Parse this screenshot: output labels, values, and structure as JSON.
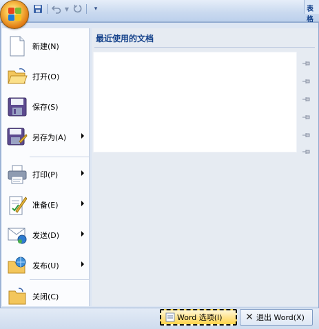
{
  "titlebar": {
    "tab_fragment": "表格"
  },
  "qat": {
    "save_icon": "save-icon",
    "undo_icon": "undo-icon",
    "redo_icon": "redo-icon",
    "customize_icon": "customize-qat-icon"
  },
  "menu": {
    "items": [
      {
        "label": "新建(N)",
        "icon": "new-document-icon",
        "has_submenu": false
      },
      {
        "label": "打开(O)",
        "icon": "open-folder-icon",
        "has_submenu": false
      },
      {
        "label": "保存(S)",
        "icon": "save-icon",
        "has_submenu": false
      },
      {
        "label": "另存为(A)",
        "icon": "save-as-icon",
        "has_submenu": true
      },
      {
        "label": "打印(P)",
        "icon": "print-icon",
        "has_submenu": true
      },
      {
        "label": "准备(E)",
        "icon": "prepare-icon",
        "has_submenu": true
      },
      {
        "label": "发送(D)",
        "icon": "send-icon",
        "has_submenu": true
      },
      {
        "label": "发布(U)",
        "icon": "publish-icon",
        "has_submenu": true
      },
      {
        "label": "关闭(C)",
        "icon": "close-folder-icon",
        "has_submenu": false
      }
    ]
  },
  "recent": {
    "title": "最近使用的文档",
    "items": []
  },
  "buttons": {
    "options_label": "Word 选项(I)",
    "exit_label": "退出 Word(X)"
  },
  "colors": {
    "accent": "#15428b",
    "menu_bg": "#dde6f3",
    "office_orange": "#e07a12"
  }
}
